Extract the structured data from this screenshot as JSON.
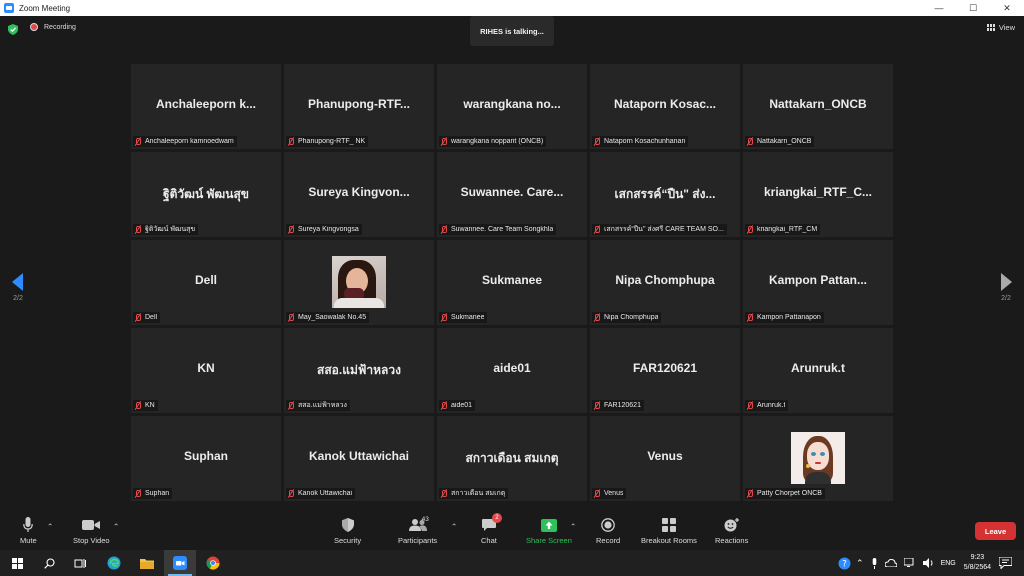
{
  "window": {
    "title": "Zoom Meeting",
    "controls": [
      "—",
      "☐",
      "✕"
    ]
  },
  "topbar": {
    "recording_label": "Recording",
    "talking_label": "RIHES is talking...",
    "view_label": "View"
  },
  "pager": {
    "left": "2/2",
    "right": "2/2"
  },
  "participants": [
    {
      "big": "Anchaleeporn  k...",
      "name": "Anchaleeporn kamnoedwam"
    },
    {
      "big": "Phanupong-RTF...",
      "name": "Phanupong-RTF_ NK"
    },
    {
      "big": "warangkana  no...",
      "name": "warangkana nopparit (ONCB)"
    },
    {
      "big": "Nataporn  Kosac...",
      "name": "Nataporn Kosachunhanan"
    },
    {
      "big": "Nattakarn_ONCB",
      "name": "Nattakarn_ONCB"
    },
    {
      "big": "ฐิติวัฒน์ พัฒนสุข",
      "name": "ฐิติวัฒน์ พัฒนสุข"
    },
    {
      "big": "Sureya  Kingvon...",
      "name": "Sureya Kingvongsa"
    },
    {
      "big": "Suwannee. Care...",
      "name": "Suwannee. Care Team Songkhla"
    },
    {
      "big": "เสกสรรค์“ปืน\"  ส่ง...",
      "name": "เสกสรรค์“ปืน\" ส่งศรี CARE TEAM SO..."
    },
    {
      "big": "kriangkai_RTF_C...",
      "name": "kriangkai_RTF_CM"
    },
    {
      "big": "Dell",
      "name": "Dell"
    },
    {
      "big": "",
      "name": "May_Saowalak No.45",
      "photo": "may"
    },
    {
      "big": "Sukmanee",
      "name": "Sukmanee"
    },
    {
      "big": "Nipa Chomphupa",
      "name": "Nipa Chomphupa"
    },
    {
      "big": "Kampon  Pattan...",
      "name": "Kampon Pattanapon"
    },
    {
      "big": "KN",
      "name": "KN"
    },
    {
      "big": "สสอ.แม่ฟ้าหลวง",
      "name": "สสอ.แม่ฟ้าหลวง"
    },
    {
      "big": "aide01",
      "name": "aide01"
    },
    {
      "big": "FAR120621",
      "name": "FAR120621"
    },
    {
      "big": "Arunruk.t",
      "name": "Arunruk.t"
    },
    {
      "big": "Suphan",
      "name": "Suphan"
    },
    {
      "big": "Kanok Uttawichai",
      "name": "Kanok Uttawichai"
    },
    {
      "big": "สกาวเดือน สมเกตุ",
      "name": "สกาวเดือน สมเกตุ"
    },
    {
      "big": "Venus",
      "name": "Venus"
    },
    {
      "big": "",
      "name": "Patty Chorpet ONCB",
      "photo": "patty"
    }
  ],
  "toolbar": {
    "mute": "Mute",
    "stop_video": "Stop Video",
    "security": "Security",
    "participants": "Participants",
    "participants_count": "43",
    "chat": "Chat",
    "chat_badge": "2",
    "share_screen": "Share Screen",
    "record": "Record",
    "breakout_rooms": "Breakout Rooms",
    "reactions": "Reactions",
    "leave": "Leave"
  },
  "taskbar": {
    "lang": "ENG",
    "time": "9:23",
    "date": "5/8/2564"
  },
  "colors": {
    "accent": "#2d8cff",
    "leave": "#d53333",
    "share": "#2fbf5b",
    "muted": "#e0494b"
  }
}
